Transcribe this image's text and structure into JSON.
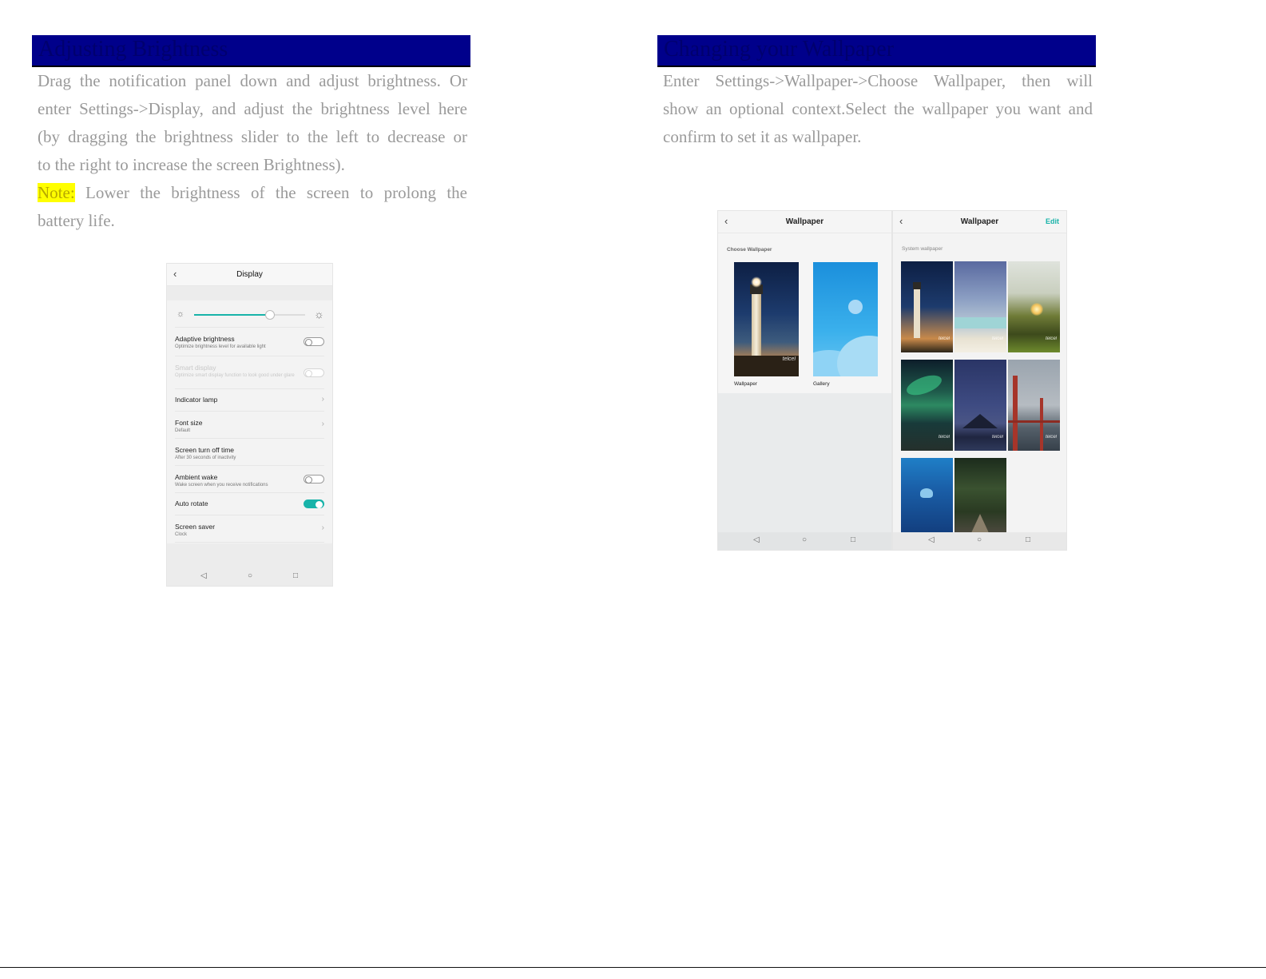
{
  "left": {
    "heading": "Adjusting Brightness",
    "lines": [
      "Drag the notification panel down and adjust brightness. Or",
      "enter Settings->Display, and adjust the brightness level here",
      "(by dragging the brightness slider to the left to decrease or",
      "to the right to increase the screen Brightness)."
    ],
    "note_label": "Note:",
    "note_line1": " Lower the brightness of the screen to prolong the",
    "note_line2": "battery life."
  },
  "right": {
    "heading": "Changing your Wallpaper",
    "lines": [
      "Enter Settings->Wallpaper->Choose Wallpaper, then will",
      "show an optional context.Select the wallpaper you want and",
      "confirm to set it as wallpaper."
    ]
  },
  "display_screen": {
    "title": "Display",
    "brightness_level": 0.68,
    "rows": [
      {
        "label": "Adaptive brightness",
        "sub": "Optimize brightness level for available light",
        "control": "toggle",
        "on": false
      },
      {
        "label": "Smart display",
        "sub": "Optimize smart display function to look good under glare",
        "control": "toggle",
        "on": false,
        "disabled": true
      },
      {
        "label": "Indicator lamp",
        "sub": "",
        "control": "chevron"
      },
      {
        "label": "Font size",
        "sub": "Default",
        "control": "chevron"
      },
      {
        "label": "Screen turn off time",
        "sub": "After 30 seconds of inactivity",
        "control": "none"
      },
      {
        "label": "Ambient wake",
        "sub": "Wake screen when you receive notifications",
        "control": "toggle",
        "on": false
      },
      {
        "label": "Auto rotate",
        "sub": "",
        "control": "toggle",
        "on": true
      },
      {
        "label": "Screen saver",
        "sub": "Clock",
        "control": "chevron"
      }
    ]
  },
  "wallpaper_screen1": {
    "title": "Wallpaper",
    "section": "Choose Wallpaper",
    "items": [
      "Wallpaper",
      "Gallery"
    ],
    "brand": "telcel"
  },
  "wallpaper_screen2": {
    "title": "Wallpaper",
    "edit": "Edit",
    "section": "System wallpaper",
    "brand": "telcel"
  },
  "colors": {
    "heading_bar": "#00008b",
    "accent": "#18b3a9",
    "note_highlight": "#ffff00"
  }
}
